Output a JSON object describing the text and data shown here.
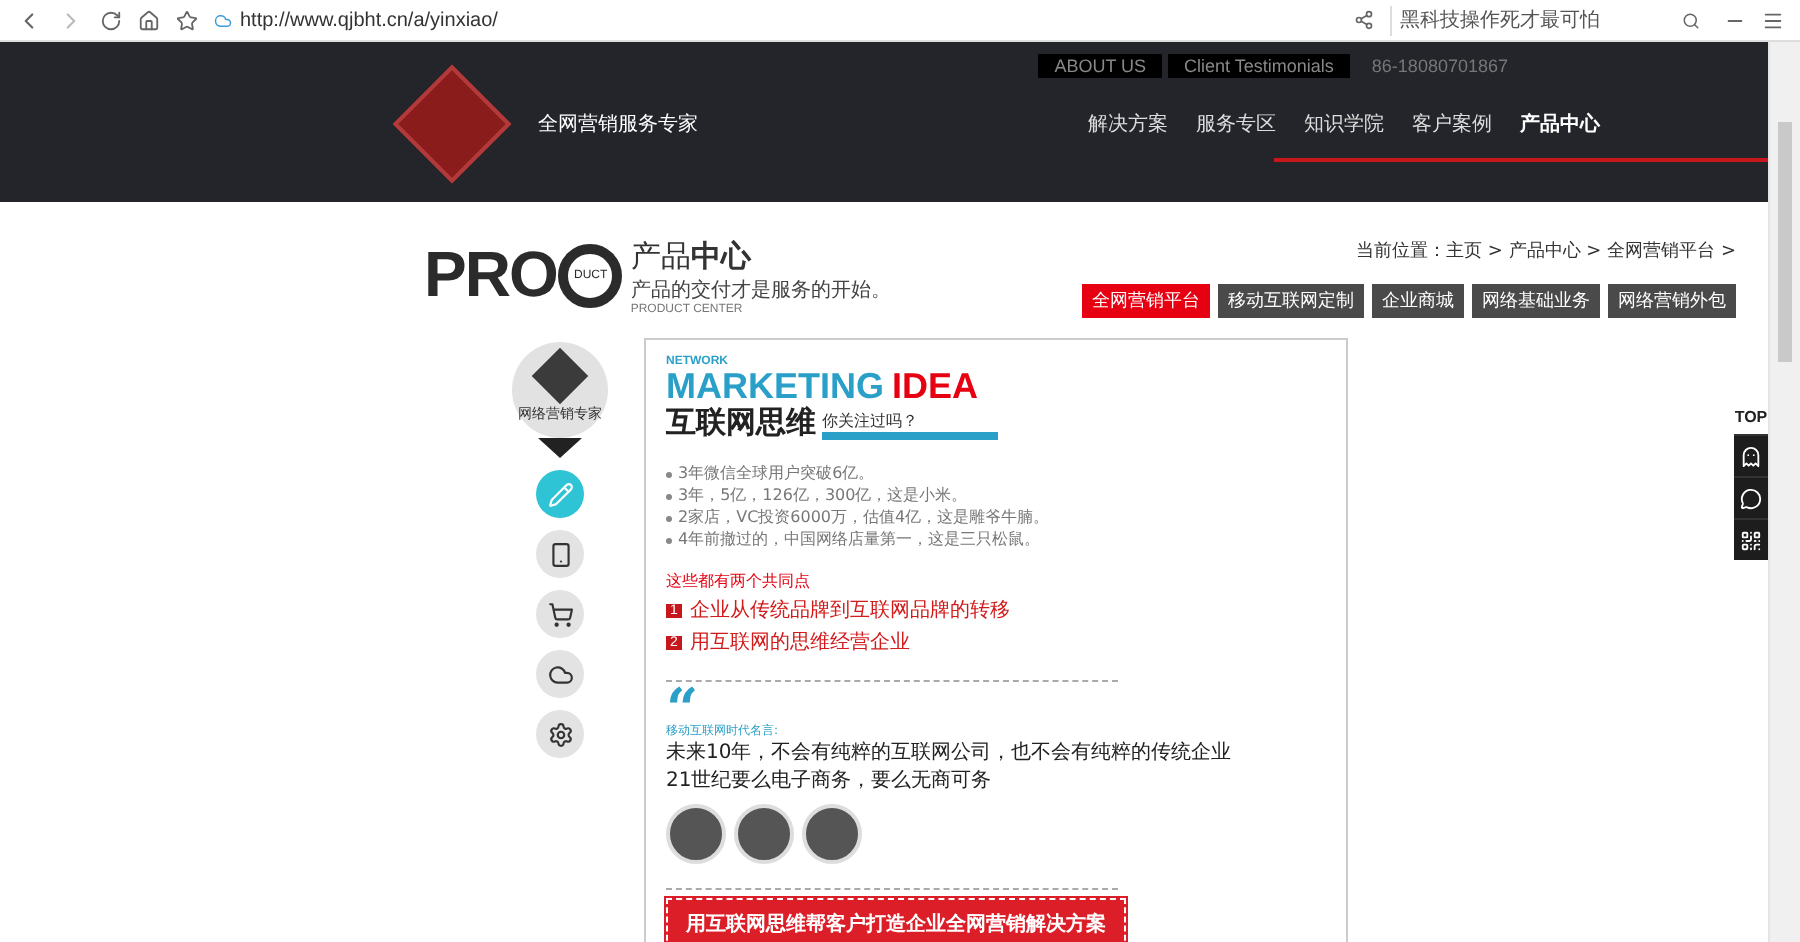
{
  "browser": {
    "url": "http://www.qjbht.cn/a/yinxiao/",
    "search": {
      "placeholder": "黑科技操作死才最可怕"
    }
  },
  "header": {
    "tagline": "全网营销服务专家",
    "top_links": [
      "ABOUT US",
      "Client Testimonials"
    ],
    "phone": "86-18080701867",
    "nav": [
      {
        "label": "解决方案",
        "selected": false
      },
      {
        "label": "服务专区",
        "selected": false
      },
      {
        "label": "知识学院",
        "selected": false
      },
      {
        "label": "客户案例",
        "selected": false
      },
      {
        "label": "产品中心",
        "selected": true
      }
    ]
  },
  "page_title": {
    "logo_text": "PRO",
    "logo_sub": "DUCT",
    "title": "产品**中心**",
    "subtitle": "产品的交付才是服务的开始。",
    "english": "PRODUCT CENTER"
  },
  "breadcrumb": "当前位置：主页 > 产品中心 > 全网营销平台 >",
  "tabs": [
    {
      "label": "全网营销平台",
      "selected": true
    },
    {
      "label": "移动互联网定制",
      "selected": false
    },
    {
      "label": "企业商城",
      "selected": false
    },
    {
      "label": "网络基础业务",
      "selected": false
    },
    {
      "label": "网络营销外包",
      "selected": false
    }
  ],
  "side_menu": {
    "badge_text": "网络营销专家",
    "items": [
      {
        "kind": "pencil",
        "selected": true
      },
      {
        "kind": "phone",
        "selected": false
      },
      {
        "kind": "cart",
        "selected": false
      },
      {
        "kind": "cloud",
        "selected": false
      },
      {
        "kind": "gear",
        "selected": false
      }
    ]
  },
  "article": {
    "kicker": "NETWORK",
    "headline_1": "MARKETING",
    "headline_2": "IDEA",
    "title": "互联网思维",
    "question": "你关注过吗？",
    "bullets": [
      "3年微信全球用户突破6亿。",
      "3年，5亿，126亿，300亿，这是小米。",
      "2家店，VC投资6000万，估值4亿，这是雕爷牛腩。",
      "4年前撤过的，中国网络店量第一，这是三只松鼠。"
    ],
    "common_heading": "这些都有两个共同点",
    "points": [
      {
        "num": "1",
        "text": "企业从传统品牌到互联网品牌的转移"
      },
      {
        "num": "2",
        "text": "用互联网的思维经营企业"
      }
    ],
    "quote_mark": "“",
    "quote_source": "移动互联网时代名言:",
    "quotes": [
      "未来10年，不会有纯粹的互联网公司，也不会有纯粹的传统企业",
      "21世纪要么电子商务，要么无商可务"
    ],
    "avatars": [
      {
        "kind": "photo"
      },
      {
        "kind": "photo"
      },
      {
        "kind": "photo"
      }
    ],
    "cta": "用互联网思维帮客户打造企业全网营销解决方案"
  },
  "float_bar": {
    "top_label": "TOP",
    "items": [
      {
        "kind": "qq"
      },
      {
        "kind": "chat"
      },
      {
        "kind": "qr"
      }
    ]
  }
}
